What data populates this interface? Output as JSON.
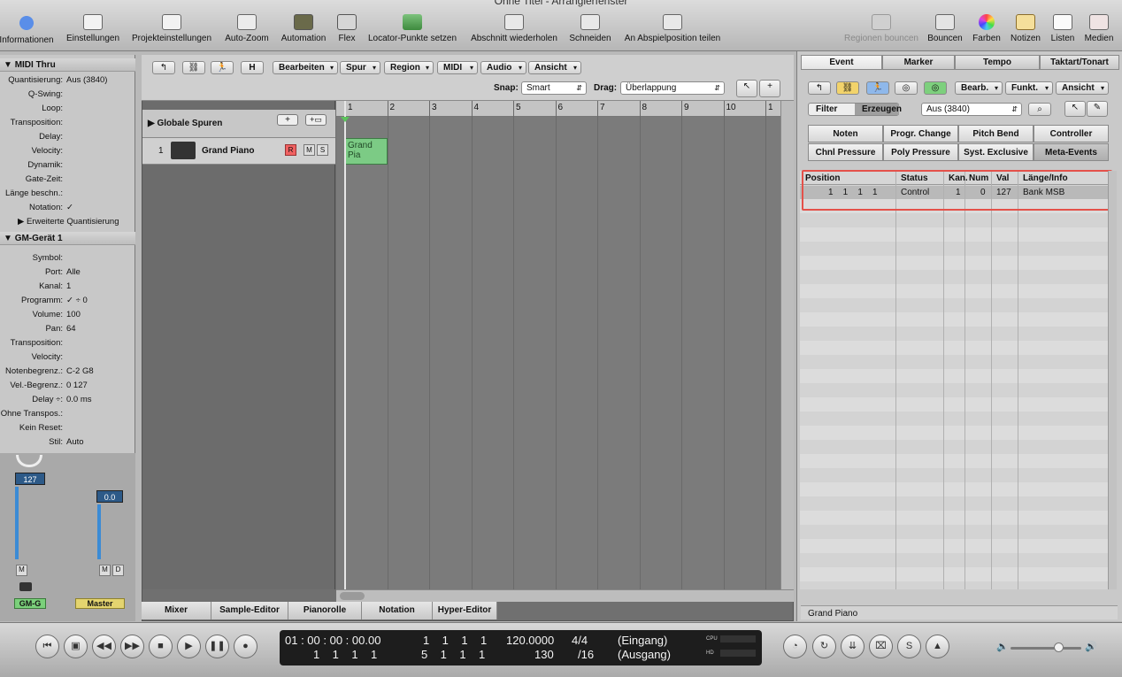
{
  "window": {
    "title": "Ohne Titel - Arrangierfenster"
  },
  "toolbar": {
    "items": [
      {
        "label": "Informationen",
        "icon": "info-icon"
      },
      {
        "label": "Einstellungen",
        "icon": "settings-icon"
      },
      {
        "label": "Projekteinstellungen",
        "icon": "project-settings-icon"
      },
      {
        "label": "Auto-Zoom",
        "icon": "zoom-icon"
      },
      {
        "label": "Automation",
        "icon": "automation-icon"
      },
      {
        "label": "Flex",
        "icon": "flex-icon"
      },
      {
        "label": "Locator-Punkte setzen",
        "icon": "locator-icon"
      },
      {
        "label": "Abschnitt wiederholen",
        "icon": "repeat-section-icon"
      },
      {
        "label": "Schneiden",
        "icon": "scissors-icon"
      },
      {
        "label": "An Abspielposition teilen",
        "icon": "split-icon"
      },
      {
        "label": "Regionen bouncen",
        "icon": "bounce-regions-icon"
      },
      {
        "label": "Bouncen",
        "icon": "bounce-icon"
      },
      {
        "label": "Farben",
        "icon": "colors-icon"
      },
      {
        "label": "Notizen",
        "icon": "notes-icon"
      },
      {
        "label": "Listen",
        "icon": "lists-icon"
      },
      {
        "label": "Medien",
        "icon": "media-icon"
      }
    ]
  },
  "inspector": {
    "midi_thru": {
      "header": "MIDI Thru",
      "rows": [
        {
          "label": "Quantisierung:",
          "value": "Aus (3840)"
        },
        {
          "label": "Q-Swing:",
          "value": ""
        },
        {
          "label": "Loop:",
          "value": ""
        },
        {
          "label": "Transposition:",
          "value": ""
        },
        {
          "label": "Delay:",
          "value": ""
        },
        {
          "label": "Velocity:",
          "value": ""
        },
        {
          "label": "Dynamik:",
          "value": ""
        },
        {
          "label": "Gate-Zeit:",
          "value": ""
        },
        {
          "label": "Länge beschn.:",
          "value": ""
        },
        {
          "label": "Notation:",
          "value": "✓"
        }
      ],
      "advanced": "Erweiterte Quantisierung"
    },
    "gm_device": {
      "header": "GM-Gerät  1",
      "rows": [
        {
          "label": "Symbol:",
          "value": ""
        },
        {
          "label": "Port:",
          "value": "Alle"
        },
        {
          "label": "Kanal:",
          "value": "1"
        },
        {
          "label": "Programm:",
          "value": "✓  ÷   0"
        },
        {
          "label": "Volume:",
          "value": "100"
        },
        {
          "label": "Pan:",
          "value": "64"
        },
        {
          "label": "Transposition:",
          "value": ""
        },
        {
          "label": "Velocity:",
          "value": ""
        },
        {
          "label": "Notenbegrenz.:",
          "value": "C-2   G8"
        },
        {
          "label": "Vel.-Begrenz.:",
          "value": "0      127"
        },
        {
          "label": "Delay ÷:",
          "value": "0.0 ms"
        },
        {
          "label": "Ohne Transpos.:",
          "value": ""
        },
        {
          "label": "Kein Reset:",
          "value": ""
        },
        {
          "label": "Stil:",
          "value": "Auto"
        }
      ]
    },
    "strip1": {
      "value": "127",
      "name": "GM-G",
      "m": "M"
    },
    "strip2": {
      "value": "0.0",
      "name": "Master",
      "m": "M",
      "d": "D"
    }
  },
  "arrange": {
    "menus": [
      "Bearbeiten",
      "Spur",
      "Region",
      "MIDI",
      "Audio",
      "Ansicht"
    ],
    "snap_label": "Snap:",
    "snap_value": "Smart",
    "drag_label": "Drag:",
    "drag_value": "Überlappung",
    "global_tracks": "Globale Spuren",
    "track": {
      "number": "1",
      "name": "Grand Piano",
      "r": "R",
      "m": "M",
      "s": "S",
      "region": "Grand Pia"
    },
    "bars": [
      "1",
      "2",
      "3",
      "4",
      "5",
      "6",
      "7",
      "8",
      "9",
      "10",
      "1"
    ],
    "h_button": "H",
    "bottom_tabs": [
      "Mixer",
      "Sample-Editor",
      "Pianorolle",
      "Notation",
      "Hyper-Editor"
    ]
  },
  "list": {
    "tabs": [
      "Event",
      "Marker",
      "Tempo",
      "Taktart/Tonart"
    ],
    "menus": [
      "Bearb.",
      "Funkt.",
      "Ansicht"
    ],
    "filter": "Filter",
    "create": "Erzeugen",
    "quant": "Aus (3840)",
    "event_types": [
      "Noten",
      "Progr. Change",
      "Pitch Bend",
      "Controller",
      "Chnl Pressure",
      "Poly Pressure",
      "Syst. Exclusive",
      "Meta-Events"
    ],
    "columns": [
      "Position",
      "Status",
      "Kan.",
      "Num",
      "Val",
      "Länge/Info"
    ],
    "row": {
      "position": "1    1    1    1",
      "status": "Control",
      "kan": "1",
      "num": "0",
      "val": "127",
      "info": "Bank MSB"
    },
    "footer": "Grand Piano",
    "highlight_color": "#e4514a"
  },
  "transport": {
    "smpte": "01 : 00 : 00 : 00.00",
    "bars_beats": "1    1    1    1",
    "left_locator": "1    1    1    1",
    "right_locator": "5    1    1    1",
    "tempo": "120.0000",
    "division": "130",
    "sig_top": "4/4",
    "sig_bottom": "/16",
    "in": "(Eingang)",
    "out": "(Ausgang)",
    "cpu": "CPU",
    "hd": "HD"
  }
}
